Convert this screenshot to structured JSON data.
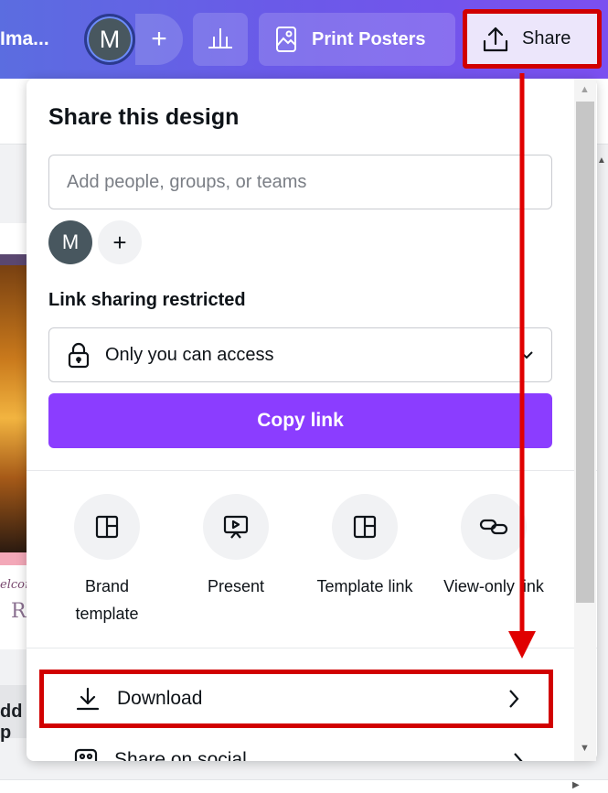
{
  "header": {
    "design_title": "Ima...",
    "avatar_initial": "M",
    "add_label": "+",
    "print_label": "Print Posters",
    "share_label": "Share"
  },
  "background": {
    "preview_text_1": "elcom",
    "preview_text_2": "R",
    "add_page_text": "dd p"
  },
  "panel": {
    "title": "Share this design",
    "invite_placeholder": "Add people, groups, or teams",
    "collaborator_initial": "M",
    "add_collaborator": "+",
    "link_heading": "Link sharing restricted",
    "access_value": "Only you can access",
    "copy_link": "Copy link",
    "options": [
      {
        "label_line1": "Brand",
        "label_line2": "template",
        "icon": "layout-icon"
      },
      {
        "label_line1": "Present",
        "label_line2": "",
        "icon": "presentation-icon"
      },
      {
        "label_line1": "Template link",
        "label_line2": "",
        "icon": "layout-icon"
      },
      {
        "label_line1": "View-only link",
        "label_line2": "",
        "icon": "link-icon"
      }
    ],
    "download": "Download",
    "share_social": "Share on social"
  },
  "colors": {
    "accent": "#8b3dff",
    "highlight": "#d10000",
    "header_start": "#5b6de0",
    "header_end": "#7b4ff0"
  }
}
